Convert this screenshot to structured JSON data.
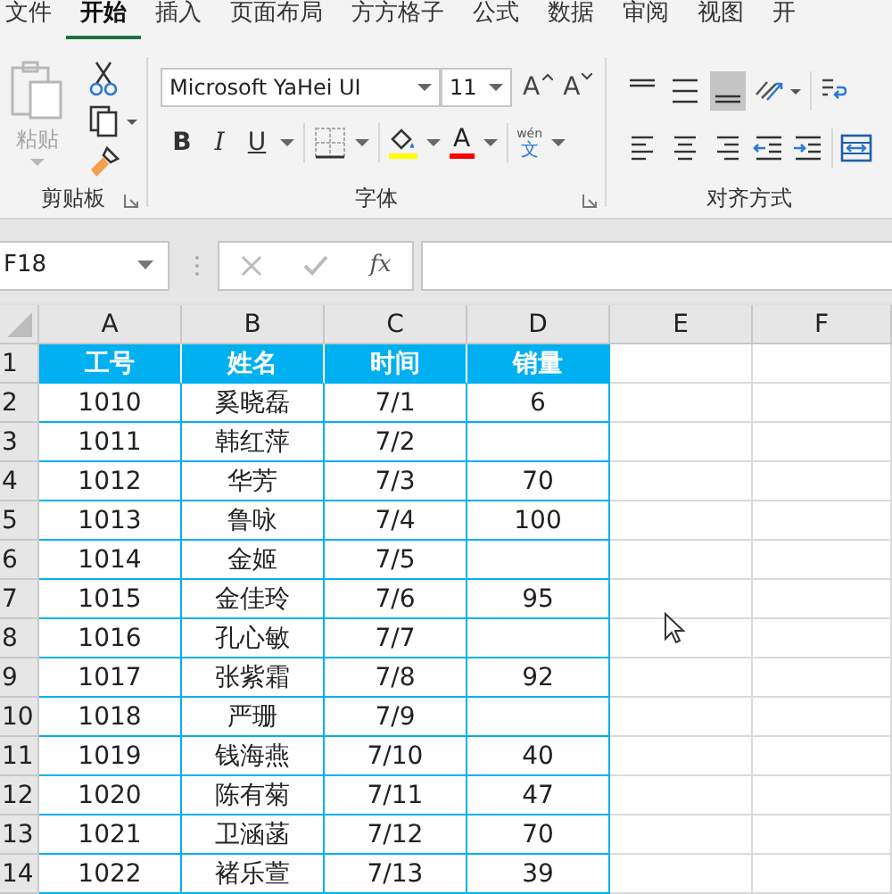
{
  "tabs": [
    {
      "label": "文件",
      "selected": false
    },
    {
      "label": "开始",
      "selected": true
    },
    {
      "label": "插入",
      "selected": false
    },
    {
      "label": "页面布局",
      "selected": false
    },
    {
      "label": "方方格子",
      "selected": false
    },
    {
      "label": "公式",
      "selected": false
    },
    {
      "label": "数据",
      "selected": false
    },
    {
      "label": "审阅",
      "selected": false
    },
    {
      "label": "视图",
      "selected": false
    },
    {
      "label": "开",
      "selected": false
    }
  ],
  "ribbon": {
    "clipboard": {
      "title": "剪贴板",
      "paste_label": "粘贴",
      "paste_disabled": true
    },
    "font": {
      "title": "字体",
      "font_name": "Microsoft YaHei UI",
      "font_size": "11",
      "grow_label": "A",
      "shrink_label": "A",
      "bold_label": "B",
      "italic_label": "I",
      "underline_label": "U",
      "font_color_label": "A",
      "phonetic_top": "wén",
      "phonetic_bottom": "文"
    },
    "alignment": {
      "title": "对齐方式",
      "vertical": [
        {
          "kind": "top",
          "selected": false
        },
        {
          "kind": "middle",
          "selected": false
        },
        {
          "kind": "bottom",
          "selected": true
        }
      ],
      "horizontal": [
        {
          "kind": "left",
          "selected": false
        },
        {
          "kind": "center",
          "selected": false
        },
        {
          "kind": "right",
          "selected": false
        }
      ]
    }
  },
  "formula_bar": {
    "name_box": "F18",
    "fx": "fx"
  },
  "sheet": {
    "columns": [
      "A",
      "B",
      "C",
      "D",
      "E",
      "F"
    ],
    "rows": [
      {
        "number": "1",
        "kind": "header",
        "cells": [
          "工号",
          "姓名",
          "时间",
          "销量"
        ]
      },
      {
        "number": "2",
        "kind": "data",
        "cells": [
          "1010",
          "奚晓磊",
          "7/1",
          "6"
        ]
      },
      {
        "number": "3",
        "kind": "data",
        "cells": [
          "1011",
          "韩红萍",
          "7/2",
          ""
        ]
      },
      {
        "number": "4",
        "kind": "data",
        "cells": [
          "1012",
          "华芳",
          "7/3",
          "70"
        ]
      },
      {
        "number": "5",
        "kind": "data",
        "cells": [
          "1013",
          "鲁咏",
          "7/4",
          "100"
        ]
      },
      {
        "number": "6",
        "kind": "data",
        "cells": [
          "1014",
          "金姬",
          "7/5",
          ""
        ]
      },
      {
        "number": "7",
        "kind": "data",
        "cells": [
          "1015",
          "金佳玲",
          "7/6",
          "95"
        ]
      },
      {
        "number": "8",
        "kind": "data",
        "cells": [
          "1016",
          "孔心敏",
          "7/7",
          ""
        ]
      },
      {
        "number": "9",
        "kind": "data",
        "cells": [
          "1017",
          "张紫霜",
          "7/8",
          "92"
        ]
      },
      {
        "number": "10",
        "kind": "data",
        "cells": [
          "1018",
          "严珊",
          "7/9",
          ""
        ]
      },
      {
        "number": "11",
        "kind": "data",
        "cells": [
          "1019",
          "钱海燕",
          "7/10",
          "40"
        ]
      },
      {
        "number": "12",
        "kind": "data",
        "cells": [
          "1020",
          "陈有菊",
          "7/11",
          "47"
        ]
      },
      {
        "number": "13",
        "kind": "data",
        "cells": [
          "1021",
          "卫涵菡",
          "7/12",
          "70"
        ]
      },
      {
        "number": "14",
        "kind": "data",
        "cells": [
          "1022",
          "褚乐萱",
          "7/13",
          "39"
        ]
      }
    ]
  }
}
